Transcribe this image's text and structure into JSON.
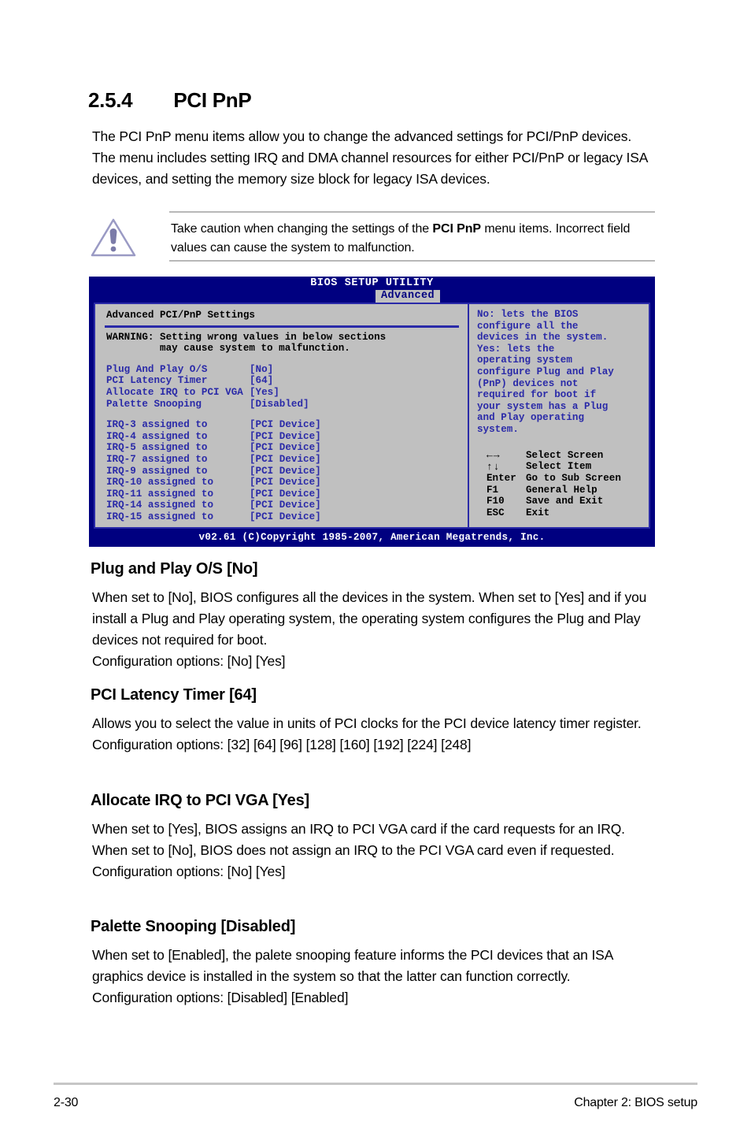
{
  "section": {
    "number": "2.5.4",
    "title": "PCI PnP",
    "intro": "The PCI PnP menu items allow you to change the advanced settings for PCI/PnP devices. The menu includes setting IRQ and DMA channel resources for either PCI/PnP or legacy ISA devices, and setting the memory size block for legacy ISA devices."
  },
  "note": {
    "icon": "warning-triangle-icon",
    "text_before": "Take caution when changing the settings of the ",
    "text_bold": "PCI PnP",
    "text_after": " menu items. Incorrect field values can cause the system to malfunction."
  },
  "bios": {
    "title": "BIOS SETUP UTILITY",
    "tab": "Advanced",
    "panel_heading": "Advanced PCI/PnP Settings",
    "warning_line1": "WARNING: Setting wrong values in below sections",
    "warning_line2": "         may cause system to malfunction.",
    "options": [
      {
        "label": "Plug And Play O/S",
        "value": "[No]"
      },
      {
        "label": "PCI Latency Timer",
        "value": "[64]"
      },
      {
        "label": "Allocate IRQ to PCI VGA",
        "value": "[Yes]"
      },
      {
        "label": "Palette Snooping",
        "value": "[Disabled]"
      }
    ],
    "irqs": [
      {
        "label": "IRQ-3 assigned to",
        "value": "[PCI Device]"
      },
      {
        "label": "IRQ-4 assigned to",
        "value": "[PCI Device]"
      },
      {
        "label": "IRQ-5 assigned to",
        "value": "[PCI Device]"
      },
      {
        "label": "IRQ-7 assigned to",
        "value": "[PCI Device]"
      },
      {
        "label": "IRQ-9 assigned to",
        "value": "[PCI Device]"
      },
      {
        "label": "IRQ-10 assigned to",
        "value": "[PCI Device]"
      },
      {
        "label": "IRQ-11 assigned to",
        "value": "[PCI Device]"
      },
      {
        "label": "IRQ-14 assigned to",
        "value": "[PCI Device]"
      },
      {
        "label": "IRQ-15 assigned to",
        "value": "[PCI Device]"
      }
    ],
    "help_lines": [
      "No: lets the BIOS",
      "configure all the",
      "devices in the system.",
      "Yes: lets the",
      "operating system",
      "configure Plug and Play",
      "(PnP) devices not",
      "required for boot if",
      "your system has a Plug",
      "and Play operating",
      "system."
    ],
    "nav": [
      {
        "key": "←→",
        "desc": "Select Screen",
        "icon": "left-right-arrows-icon"
      },
      {
        "key": "↑↓",
        "desc": "Select Item",
        "icon": "up-down-arrows-icon"
      },
      {
        "key": "Enter",
        "desc": "Go to Sub Screen",
        "icon": "enter-key-icon"
      },
      {
        "key": "F1",
        "desc": "General Help",
        "icon": "f1-key-icon"
      },
      {
        "key": "F10",
        "desc": "Save and Exit",
        "icon": "f10-key-icon"
      },
      {
        "key": "ESC",
        "desc": "Exit",
        "icon": "esc-key-icon"
      }
    ],
    "footer": "v02.61 (C)Copyright 1985-2007, American Megatrends, Inc.",
    "colors": {
      "header_bg": "#000080",
      "panel_bg": "#c0c0c0",
      "border": "#2a2aa8",
      "text_blue": "#2a2aa8",
      "tab_bg": "#c0c0c0"
    }
  },
  "sections": [
    {
      "heading": "Plug and Play O/S [No]",
      "body": "When set to [No], BIOS configures all the devices in the system. When set to [Yes] and if you install a Plug and Play operating system, the operating system configures the Plug and Play devices not required for boot.",
      "options": "Configuration options: [No] [Yes]"
    },
    {
      "heading": "PCI Latency Timer [64]",
      "body": "Allows you to select the value in units of PCI clocks for the PCI device latency timer register.",
      "options": " Configuration options: [32] [64] [96] [128] [160] [192] [224] [248]"
    },
    {
      "heading": "Allocate IRQ to PCI VGA [Yes]",
      "body": "When set to [Yes], BIOS assigns an IRQ to PCI VGA card if the card requests for an IRQ. When set to [No], BIOS does not assign an IRQ to the PCI VGA card even if requested.",
      "options": "Configuration options: [No] [Yes]"
    },
    {
      "heading": "Palette Snooping [Disabled]",
      "body": "When set to [Enabled], the palete snooping feature informs the PCI devices that an ISA graphics device is installed in the system so that the latter can function correctly.",
      "options": "Configuration options: [Disabled] [Enabled]"
    }
  ],
  "footer": {
    "page_number": "2-30",
    "chapter": "Chapter 2: BIOS setup"
  }
}
